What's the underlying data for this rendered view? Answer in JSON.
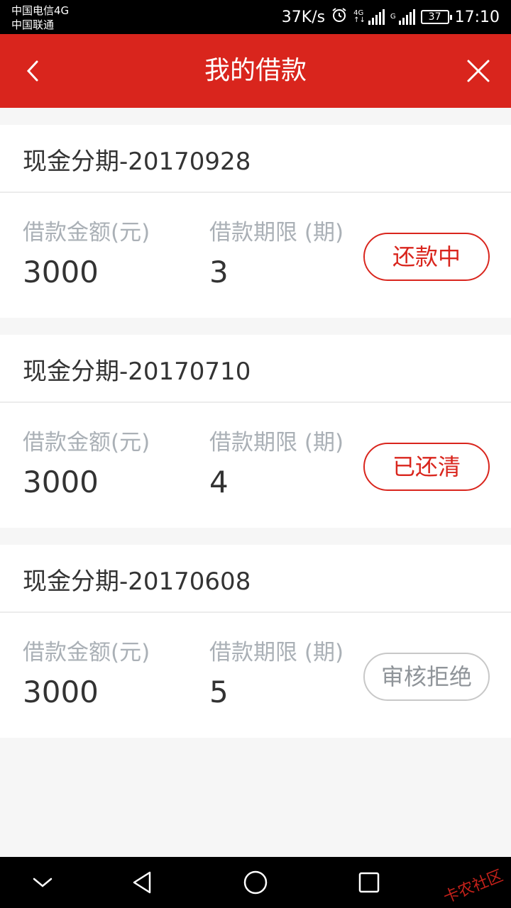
{
  "status_bar": {
    "carrier_1": "中国电信4G",
    "carrier_2": "中国联通",
    "speed": "37K/s",
    "net_1_top": "4G",
    "net_1_bottom": "↑↓",
    "net_2": "G",
    "battery": "37",
    "time": "17:10"
  },
  "header": {
    "title": "我的借款"
  },
  "loans": [
    {
      "title": "现金分期-20170928",
      "amount_label": "借款金额(元)",
      "amount": "3000",
      "term_label": "借款期限 (期)",
      "term": "3",
      "status": "还款中"
    },
    {
      "title": "现金分期-20170710",
      "amount_label": "借款金额(元)",
      "amount": "3000",
      "term_label": "借款期限 (期)",
      "term": "4",
      "status": "已还清"
    },
    {
      "title": "现金分期-20170608",
      "amount_label": "借款金额(元)",
      "amount": "3000",
      "term_label": "借款期限 (期)",
      "term": "5",
      "status": "审核拒绝"
    }
  ],
  "watermark": "卡农社区",
  "colors": {
    "brand_red": "#d9251d",
    "muted_label": "#aab0b6",
    "background": "#f6f6f6"
  }
}
